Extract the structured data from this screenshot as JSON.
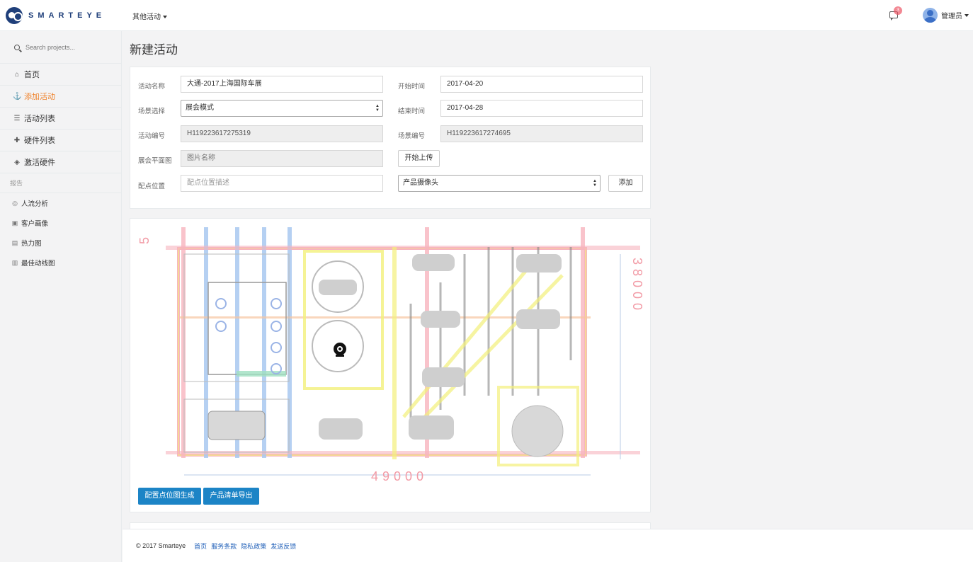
{
  "brand": {
    "name": "SMARTEYE"
  },
  "topbar": {
    "menu_label": "其他活动",
    "notification_count": "3",
    "user_name": "管理员"
  },
  "sidebar": {
    "search_placeholder": "Search projects...",
    "items": [
      {
        "label": "首页",
        "icon": "home-icon"
      },
      {
        "label": "添加活动",
        "icon": "anchor-icon",
        "active": true
      },
      {
        "label": "活动列表",
        "icon": "list-icon"
      },
      {
        "label": "硬件列表",
        "icon": "puzzle-icon"
      },
      {
        "label": "激活硬件",
        "icon": "shield-icon"
      }
    ],
    "section_label": "报告",
    "reports": [
      {
        "label": "人流分析",
        "icon": "globe-icon"
      },
      {
        "label": "客户画像",
        "icon": "image-icon"
      },
      {
        "label": "热力图",
        "icon": "file-icon"
      },
      {
        "label": "最佳动线图",
        "icon": "bar-chart-icon"
      }
    ]
  },
  "page": {
    "title": "新建活动"
  },
  "form": {
    "activity_name_label": "活动名称",
    "activity_name_value": "大通-2017上海国际车展",
    "start_time_label": "开始时间",
    "start_time_value": "2017-04-20",
    "scene_label": "场景选择",
    "scene_value": "展会模式",
    "end_time_label": "结束时间",
    "end_time_value": "2017-04-28",
    "activity_no_label": "活动编号",
    "activity_no_value": "H119223617275319",
    "scene_no_label": "场景编号",
    "scene_no_value": "H119223617274695",
    "floorplan_label": "展会平面图",
    "floorplan_placeholder": "图片名称",
    "upload_button": "开始上传",
    "point_label": "配点位置",
    "point_placeholder": "配点位置描述",
    "device_value": "产品摄像头",
    "add_button": "添加"
  },
  "map": {
    "dimension_width": "49000",
    "dimension_height": "38000",
    "dimension_left": "5",
    "primary_color": "#1c84c6"
  },
  "actions": {
    "generate_button": "配置点位图生成",
    "export_button": "产品清单导出"
  },
  "footer": {
    "copyright": "© 2017 Smarteye",
    "links": [
      "首页",
      "服务条款",
      "隐私政策",
      "发送反馈"
    ]
  }
}
